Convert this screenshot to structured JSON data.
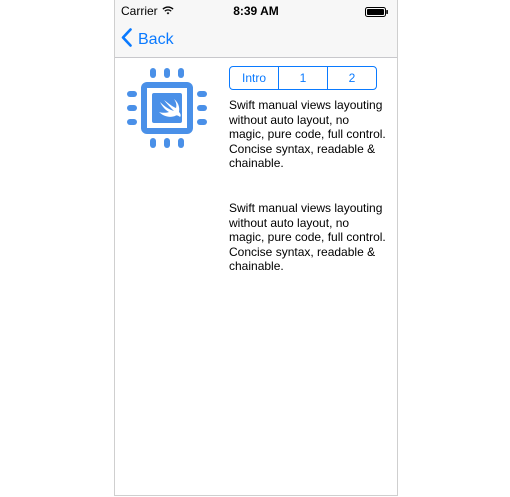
{
  "status_bar": {
    "carrier": "Carrier",
    "time": "8:39 AM"
  },
  "nav": {
    "back_label": "Back"
  },
  "segmented": {
    "items": [
      "Intro",
      "1",
      "2"
    ]
  },
  "content": {
    "paragraph_1": "Swift manual views layouting without auto layout, no magic, pure code, full control. Concise syntax, readable & chainable.",
    "paragraph_2": "Swift manual views layouting without auto layout, no magic, pure code, full control. Concise syntax, readable & chainable."
  },
  "colors": {
    "accent": "#0a7aff",
    "logo": "#4a90e8"
  },
  "icons": {
    "wifi": "wifi-icon",
    "battery": "battery-icon",
    "back": "chevron-left-icon",
    "logo": "chip-swift-logo-icon"
  }
}
